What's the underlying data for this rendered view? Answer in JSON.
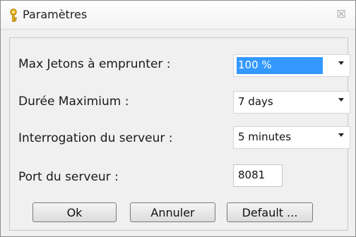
{
  "window": {
    "title": "Paramètres",
    "close_glyph": "☒"
  },
  "form": {
    "max_tokens": {
      "label": "Max Jetons à emprunter :",
      "value": "100 %"
    },
    "max_duration": {
      "label": "Durée Maximium :",
      "value": "7 days"
    },
    "server_polling": {
      "label": "Interrogation du serveur :",
      "value": "5 minutes"
    },
    "server_port": {
      "label": "Port du serveur :",
      "value": "8081"
    }
  },
  "buttons": {
    "ok": "Ok",
    "cancel": "Annuler",
    "default": "Default ..."
  },
  "icons": {
    "title_icon": "key-icon",
    "close": "close-icon",
    "dropdown": "chevron-down-icon"
  },
  "colors": {
    "selection": "#3399ff"
  }
}
